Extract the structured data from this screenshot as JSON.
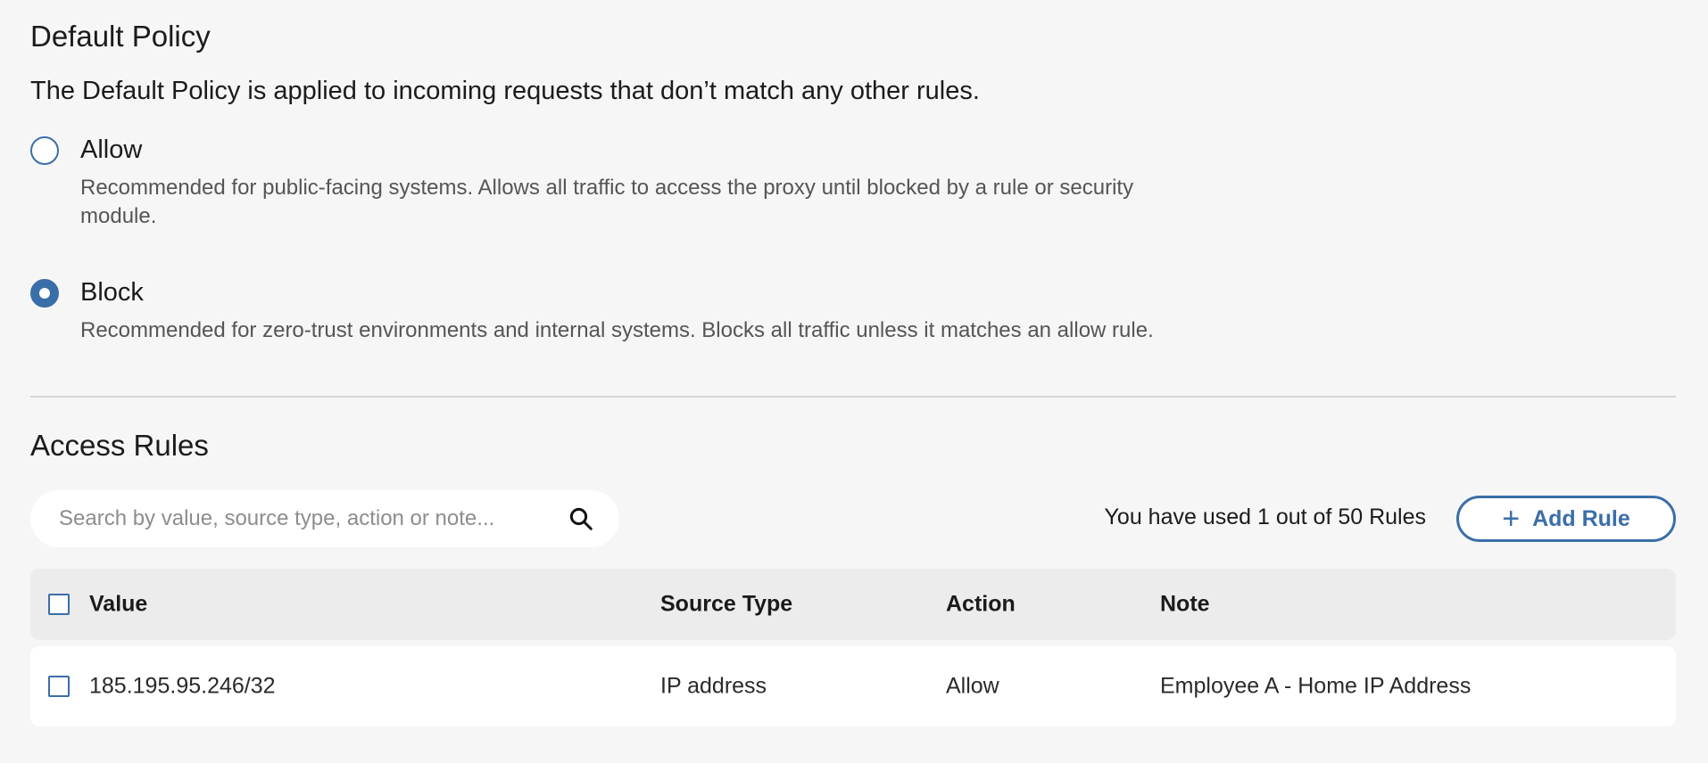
{
  "default_policy": {
    "title": "Default Policy",
    "description": "The Default Policy is applied to incoming requests that don’t match any other rules.",
    "options": [
      {
        "label": "Allow",
        "help": "Recommended for public-facing systems. Allows all traffic to access the proxy until blocked by a rule or security module.",
        "selected": false
      },
      {
        "label": "Block",
        "help": "Recommended for zero-trust environments and internal systems. Blocks all traffic unless it matches an allow rule.",
        "selected": true
      }
    ]
  },
  "access_rules": {
    "title": "Access Rules",
    "search": {
      "placeholder": "Search by value, source type, action or note...",
      "value": ""
    },
    "usage_text": "You have used 1 out of 50 Rules",
    "add_rule_label": "Add Rule",
    "table": {
      "columns": [
        "Value",
        "Source Type",
        "Action",
        "Note"
      ],
      "rows": [
        {
          "value": "185.195.95.246/32",
          "source_type": "IP address",
          "action": "Allow",
          "note": "Employee A - Home IP Address"
        }
      ]
    }
  },
  "colors": {
    "accent": "#3a6ea8",
    "background": "#f6f6f6"
  }
}
